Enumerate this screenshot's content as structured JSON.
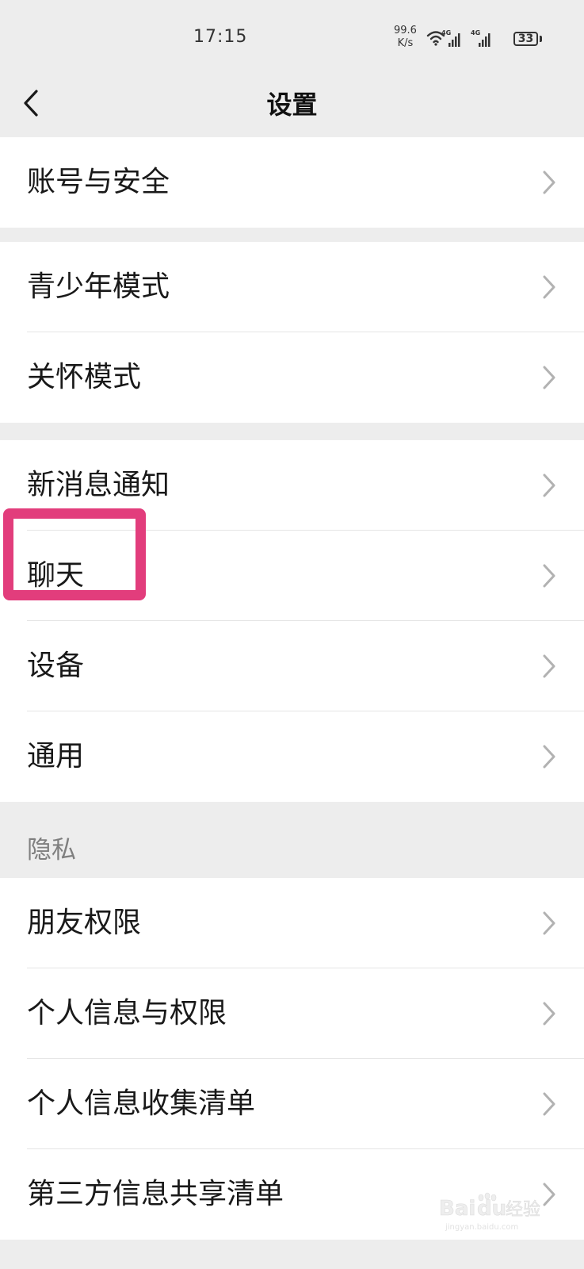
{
  "status_bar": {
    "time": "17:15",
    "net_speed_value": "99.6",
    "net_speed_unit": "K/s",
    "battery": "33",
    "signal_labels": [
      "4G",
      "4G"
    ],
    "icons": [
      "wifi-icon",
      "signal-4g-icon",
      "signal-4g-icon",
      "battery-icon"
    ]
  },
  "nav": {
    "title": "设置",
    "back_icon": "chevron-left-icon"
  },
  "groups": [
    {
      "items": [
        {
          "label": "账号与安全"
        }
      ]
    },
    {
      "items": [
        {
          "label": "青少年模式"
        },
        {
          "label": "关怀模式"
        }
      ]
    },
    {
      "items": [
        {
          "label": "新消息通知"
        },
        {
          "label": "聊天",
          "highlighted": true
        },
        {
          "label": "设备"
        },
        {
          "label": "通用"
        }
      ]
    },
    {
      "header": "隐私",
      "items": [
        {
          "label": "朋友权限"
        },
        {
          "label": "个人信息与权限"
        },
        {
          "label": "个人信息收集清单"
        },
        {
          "label": "第三方信息共享清单"
        }
      ]
    }
  ],
  "annotation": {
    "highlight_color": "#e23d7c",
    "highlight_target": "聊天"
  },
  "watermark": {
    "text_brand": "Bai",
    "text_brand_suffix": "du",
    "text_cn": "经验",
    "domain": "jingyan.baidu.com"
  },
  "colors": {
    "background": "#ededed",
    "cell": "#ffffff",
    "divider": "#e5e5e5",
    "text": "#191919",
    "section_text": "#7f7f7f",
    "chevron": "#b2b2b2"
  }
}
